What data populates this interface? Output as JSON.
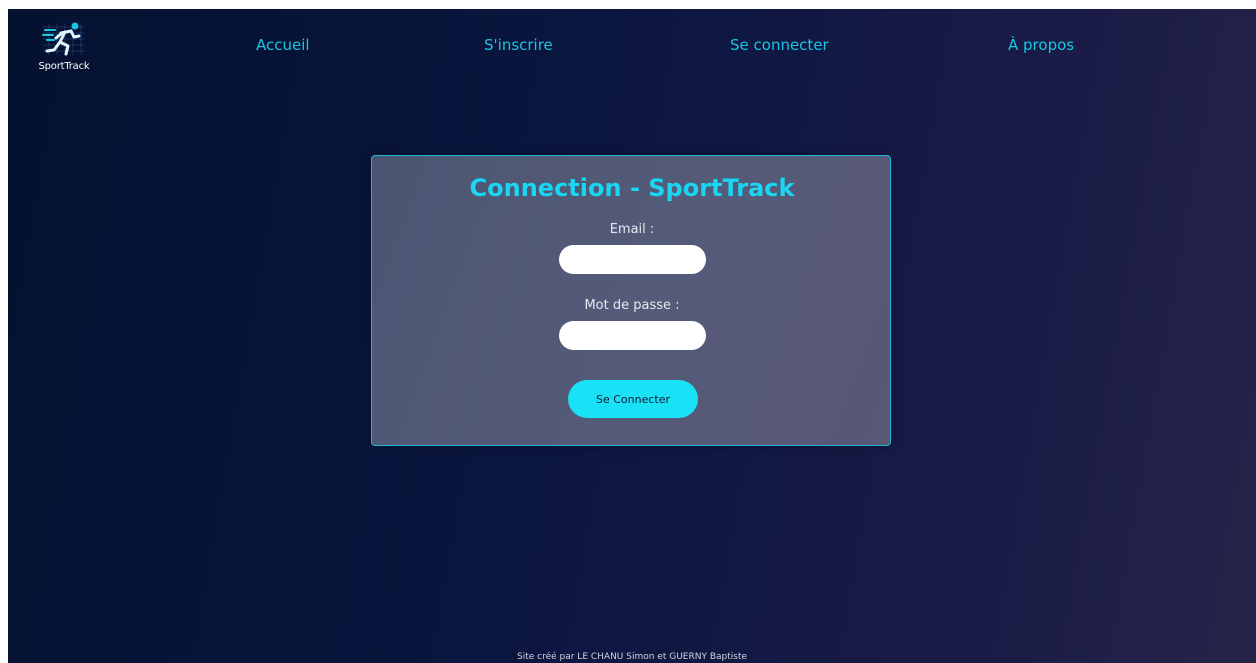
{
  "logo": {
    "text": "SportTrack",
    "icon": "runner-icon"
  },
  "nav": {
    "items": [
      {
        "label": "Accueil"
      },
      {
        "label": "S'inscrire"
      },
      {
        "label": "Se connecter"
      },
      {
        "label": "À propos"
      }
    ]
  },
  "login": {
    "title": "Connection - SportTrack",
    "email_label": "Email :",
    "email_value": "",
    "password_label": "Mot de passe :",
    "password_value": "",
    "submit_label": "Se Connecter"
  },
  "footer": {
    "text": "Site créé par LE CHANU Simon et GUERNY Baptiste"
  },
  "colors": {
    "accent": "#19c6e3",
    "button": "#19e2f7",
    "background": "#0b1640"
  }
}
